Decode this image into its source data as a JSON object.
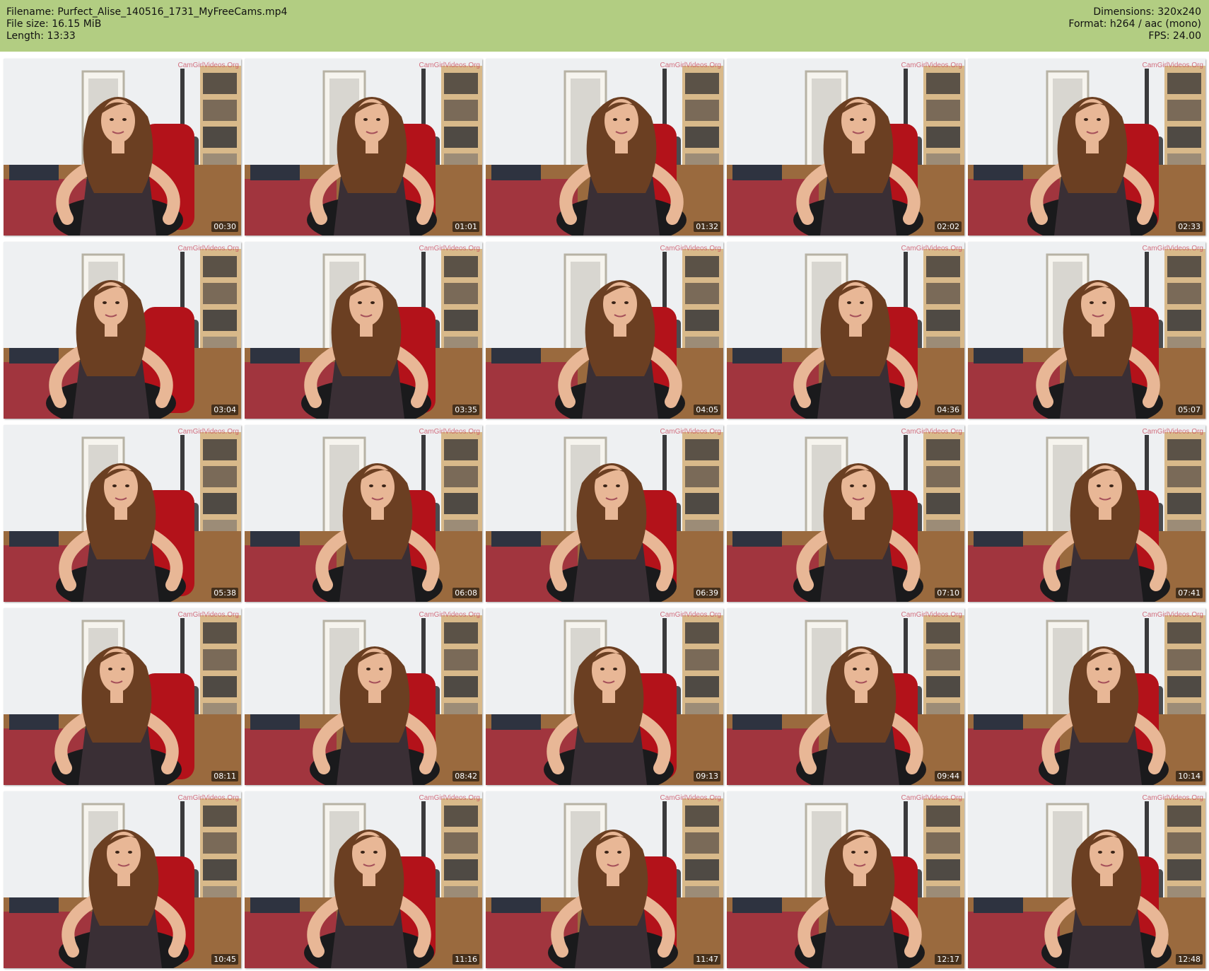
{
  "header": {
    "left": [
      {
        "label": "Filename:",
        "value": "Purfect_Alise_140516_1731_MyFreeCams.mp4"
      },
      {
        "label": "File size:",
        "value": "16.15 MiB"
      },
      {
        "label": "Length:",
        "value": "13:33"
      }
    ],
    "right": [
      {
        "label": "Dimensions:",
        "value": "320x240"
      },
      {
        "label": "Format:",
        "value": "h264 / aac (mono)"
      },
      {
        "label": "FPS:",
        "value": "24.00"
      }
    ]
  },
  "colors": {
    "header_bg": "#b2cd82",
    "chair": "#b3121a",
    "wall": "#eef0f2",
    "floor": "#9a6a3e",
    "rug": "#a22c3e",
    "hair": "#6b3f22",
    "skin": "#e8b796",
    "top": "#3a2f35"
  },
  "watermark": "CamGirlVideos.Org",
  "thumbnails": [
    {
      "time": "00:30"
    },
    {
      "time": "01:01"
    },
    {
      "time": "01:32"
    },
    {
      "time": "02:02"
    },
    {
      "time": "02:33"
    },
    {
      "time": "03:04"
    },
    {
      "time": "03:35"
    },
    {
      "time": "04:05"
    },
    {
      "time": "04:36"
    },
    {
      "time": "05:07"
    },
    {
      "time": "05:38"
    },
    {
      "time": "06:08"
    },
    {
      "time": "06:39"
    },
    {
      "time": "07:10"
    },
    {
      "time": "07:41"
    },
    {
      "time": "08:11"
    },
    {
      "time": "08:42"
    },
    {
      "time": "09:13"
    },
    {
      "time": "09:44"
    },
    {
      "time": "10:14"
    },
    {
      "time": "10:45"
    },
    {
      "time": "11:16"
    },
    {
      "time": "11:47"
    },
    {
      "time": "12:17"
    },
    {
      "time": "12:48"
    }
  ]
}
